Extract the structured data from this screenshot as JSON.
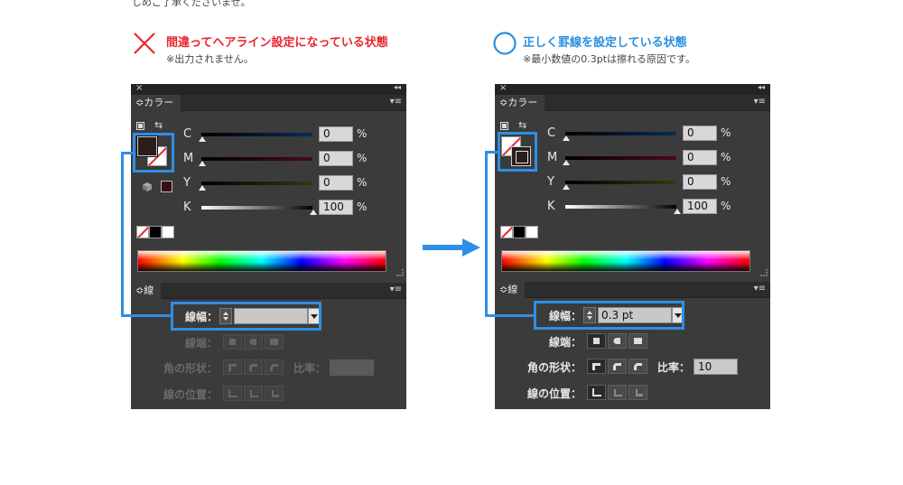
{
  "top_note": "しめご了承くださいませ。",
  "left_caption": {
    "title": "間違ってヘアライン設定になっている状態",
    "note": "※出力されません。"
  },
  "right_caption": {
    "title": "正しく罫線を設定している状態",
    "note": "※最小数値の0.3ptは擦れる原因です。"
  },
  "panel_common": {
    "close_glyph": "×",
    "collapse_glyph": "◂◂",
    "color_tab": "≎カラー",
    "stroke_tab": "≎線",
    "menu_glyph": "▾≡",
    "percent": "%",
    "labels": {
      "weight": "線幅：",
      "cap": "線端：",
      "corner": "角の形状：",
      "ratio": "比率：",
      "align": "線の位置："
    }
  },
  "left_panel": {
    "sliders": [
      {
        "label": "C",
        "value": "0"
      },
      {
        "label": "M",
        "value": "0"
      },
      {
        "label": "Y",
        "value": "0"
      },
      {
        "label": "K",
        "value": "100"
      }
    ],
    "stroke_weight": "",
    "miter_ratio": ""
  },
  "right_panel": {
    "sliders": [
      {
        "label": "C",
        "value": "0"
      },
      {
        "label": "M",
        "value": "0"
      },
      {
        "label": "Y",
        "value": "0"
      },
      {
        "label": "K",
        "value": "100"
      }
    ],
    "stroke_weight": "0.3 pt",
    "miter_ratio": "10"
  },
  "colors": {
    "error_red": "#e8262d",
    "correct_blue": "#2a8fe0",
    "highlight_blue": "#2d8fe6",
    "panel_bg": "#3b3b3b"
  }
}
